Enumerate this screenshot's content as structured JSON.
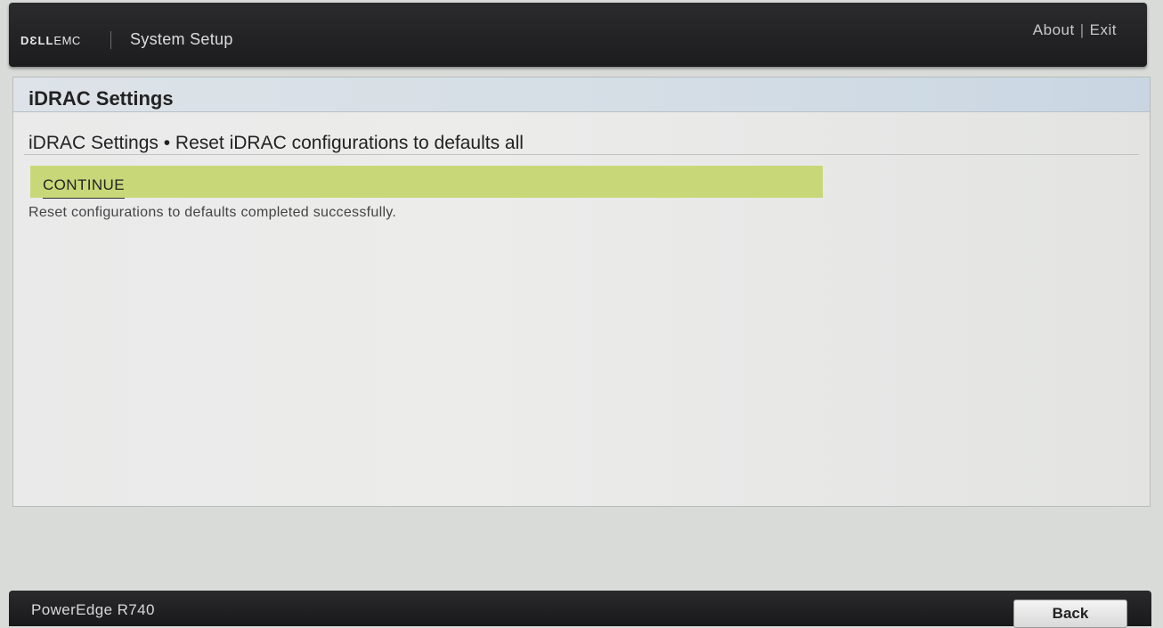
{
  "header": {
    "brand_dell": "DƐLL",
    "brand_emc": "EMC",
    "app_title": "System Setup",
    "links": {
      "about": "About",
      "separator": "|",
      "exit": "Exit"
    }
  },
  "panel": {
    "title": "iDRAC Settings",
    "subtitle": "iDRAC Settings • Reset iDRAC configurations to defaults all",
    "continue_label": "CONTINUE",
    "status_message": "Reset configurations to defaults completed successfully."
  },
  "footer": {
    "model": "PowerEdge R740",
    "back_label": "Back"
  },
  "colors": {
    "highlight": "#c8d879",
    "topbar": "#1f1f21",
    "panel_header": "#d4dde5"
  }
}
